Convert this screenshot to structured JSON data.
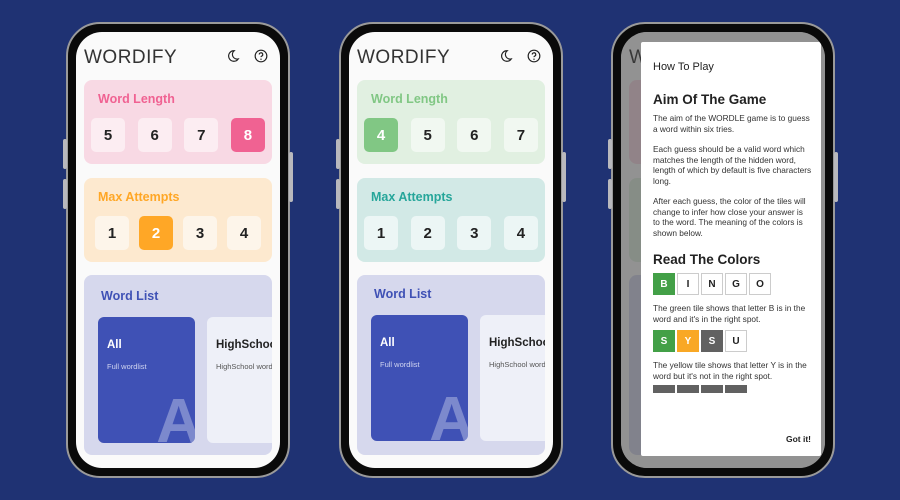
{
  "colors": {
    "background": "#1f3273",
    "pink_accent": "#f06292",
    "orange_accent": "#ffa726",
    "green_accent": "#81c784",
    "teal_accent": "#26a69a",
    "indigo_accent": "#3f51b5",
    "tile_green": "#43a047",
    "tile_yellow": "#f9a825",
    "tile_gray": "#616161"
  },
  "phones": [
    {
      "app_title": "WORDIFY",
      "word_length": {
        "title": "Word Length",
        "options": [
          "5",
          "6",
          "7",
          "8"
        ],
        "selected": "8"
      },
      "max_attempts": {
        "title": "Max Attempts",
        "options": [
          "1",
          "2",
          "3",
          "4"
        ],
        "selected": "2"
      },
      "word_list": {
        "title": "Word List",
        "items": [
          {
            "name": "All",
            "desc": "Full wordlist",
            "letter": "A"
          },
          {
            "name": "HighSchool",
            "desc": "HighSchool words"
          }
        ]
      }
    },
    {
      "app_title": "WORDIFY",
      "word_length": {
        "title": "Word Length",
        "options": [
          "4",
          "5",
          "6",
          "7"
        ],
        "selected": "4"
      },
      "max_attempts": {
        "title": "Max Attempts",
        "options": [
          "1",
          "2",
          "3",
          "4"
        ],
        "selected": null
      },
      "word_list": {
        "title": "Word List",
        "items": [
          {
            "name": "All",
            "desc": "Full wordlist",
            "letter": "A"
          },
          {
            "name": "HighSchool",
            "desc": "HighSchool words"
          }
        ]
      }
    }
  ],
  "dialog": {
    "bg_title_letter": "W",
    "title": "How To Play",
    "aim_heading": "Aim Of The Game",
    "aim_p1": "The aim of the WORDLE game is to guess a word within six tries.",
    "aim_p2": "Each guess should be a valid word which matches the length of the hidden word, length of which by default is five characters long.",
    "aim_p3": "After each guess, the color of the tiles will change to infer how close your answer is to the word. The meaning of the colors is shown below.",
    "colors_heading": "Read The Colors",
    "example1": [
      {
        "letter": "B",
        "state": "green"
      },
      {
        "letter": "I",
        "state": "empty"
      },
      {
        "letter": "N",
        "state": "empty"
      },
      {
        "letter": "G",
        "state": "empty"
      },
      {
        "letter": "O",
        "state": "empty"
      }
    ],
    "example1_text": "The green tile shows that letter B is in the word and it's in the right spot.",
    "example2": [
      {
        "letter": "S",
        "state": "green"
      },
      {
        "letter": "Y",
        "state": "yellow"
      },
      {
        "letter": "S",
        "state": "gray"
      },
      {
        "letter": "U",
        "state": "empty"
      }
    ],
    "example2_text": "The yellow tile shows that letter Y is in the word but it's not in the right spot.",
    "example3": [
      {
        "letter": "",
        "state": "gray"
      },
      {
        "letter": "",
        "state": "gray"
      },
      {
        "letter": "",
        "state": "gray"
      },
      {
        "letter": "",
        "state": "gray"
      }
    ],
    "confirm_label": "Got it!"
  }
}
